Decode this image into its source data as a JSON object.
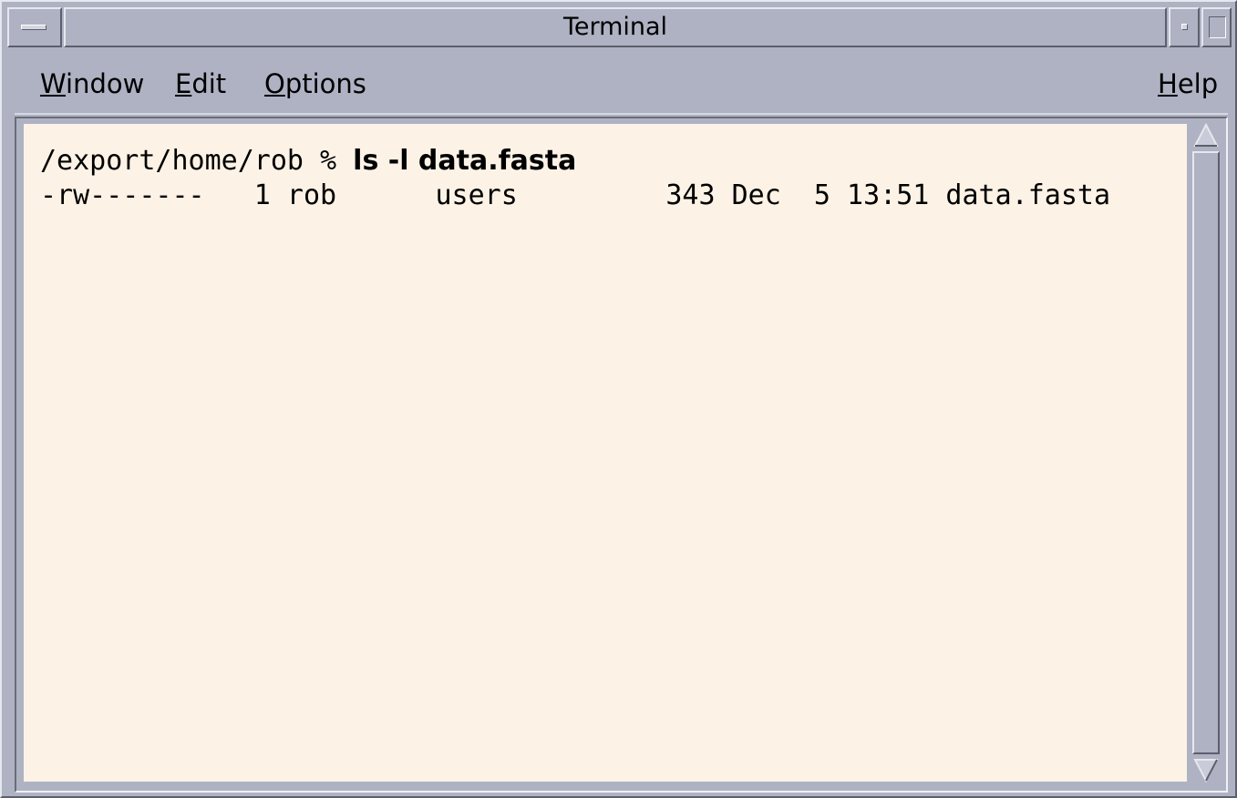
{
  "window": {
    "title": "Terminal"
  },
  "menubar": {
    "window": {
      "mnemonic": "W",
      "rest": "indow"
    },
    "edit": {
      "mnemonic": "E",
      "rest": "dit"
    },
    "options": {
      "mnemonic": "O",
      "rest": "ptions"
    },
    "help": {
      "mnemonic": "H",
      "rest": "elp"
    }
  },
  "terminal": {
    "lines": [
      {
        "prompt": "/export/home/rob % ",
        "command": "ls -l data.fasta"
      },
      {
        "output": "-rw-------   1 rob      users         343 Dec  5 13:51 data.fasta"
      }
    ]
  },
  "icons": {
    "window_menu": "window-menu-icon",
    "minimize": "minimize-icon",
    "maximize": "maximize-icon",
    "scroll_up": "scroll-up-arrow-icon",
    "scroll_down": "scroll-down-arrow-icon"
  },
  "colors": {
    "chrome": "#aeb2c3",
    "terminal_background": "#fcf3e6",
    "text": "#000000"
  }
}
